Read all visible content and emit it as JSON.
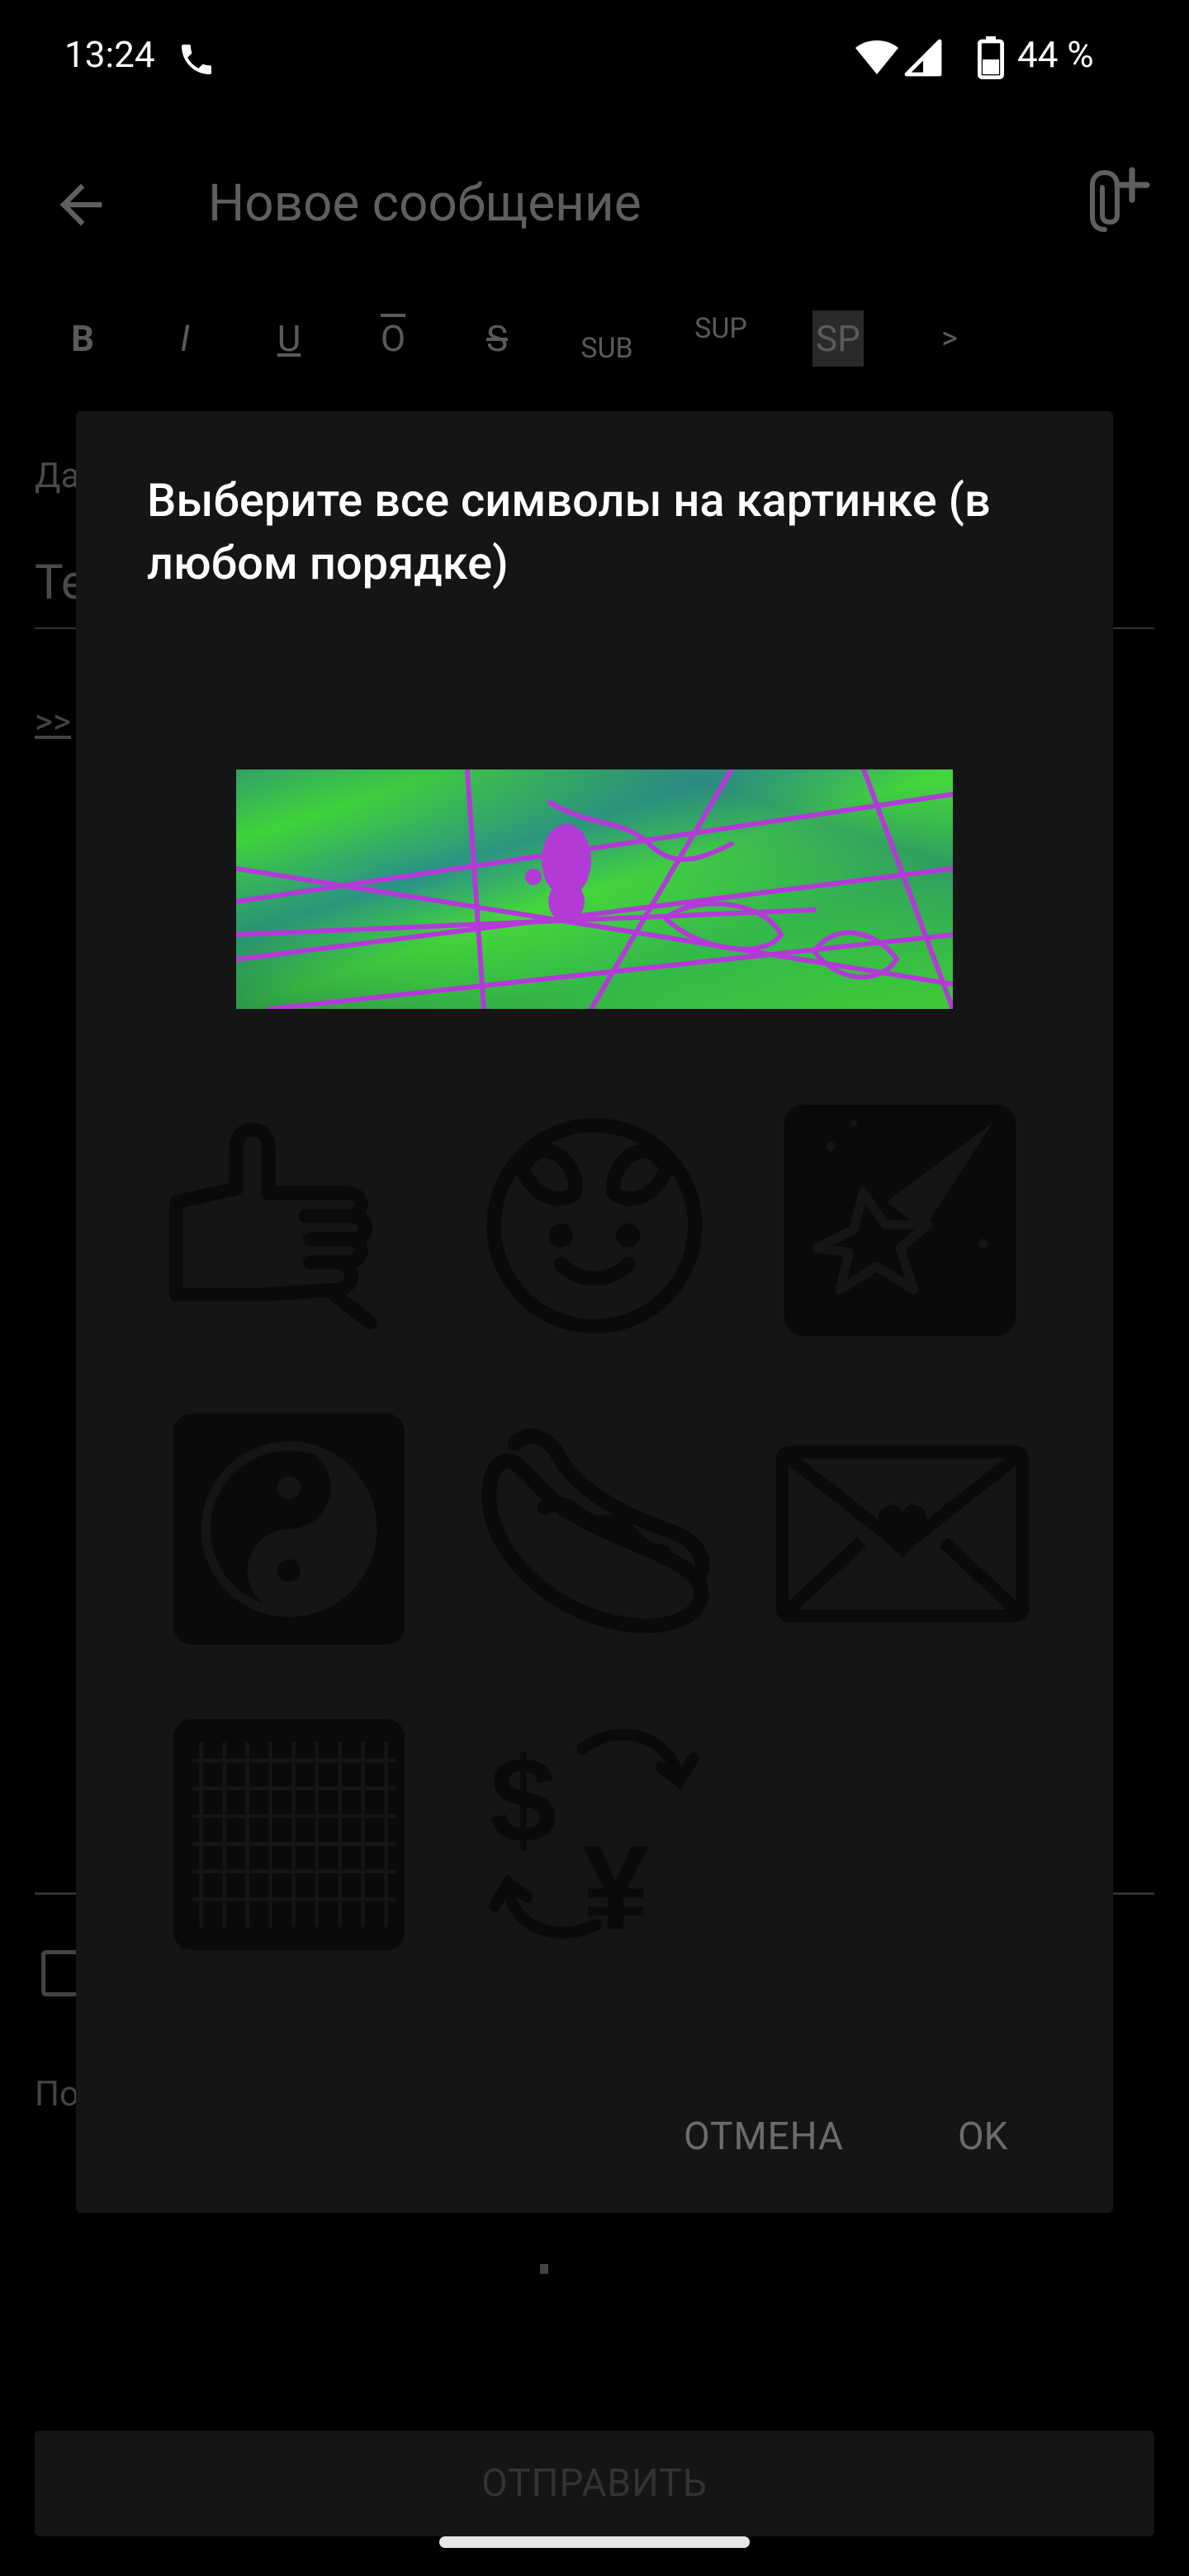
{
  "status_bar": {
    "time": "13:24",
    "battery": "44 %",
    "icons": [
      "phone-call-icon",
      "wifi-icon",
      "signal-icon",
      "battery-icon"
    ]
  },
  "app_bar": {
    "title": "Новое сообщение"
  },
  "format_toolbar": {
    "bold": "B",
    "italic": "I",
    "underline": "U",
    "overline": "O",
    "strike": "S",
    "sub": "SUB",
    "sup": "SUP",
    "sp": "SP",
    "more": ">"
  },
  "background": {
    "field_label": "Да",
    "field_input": "Те",
    "quote": ">>",
    "footer_text": "По",
    "send_button": "ОТПРАВИТЬ"
  },
  "dialog": {
    "title": "Выберите все символы на картинке (в любом порядке)",
    "symbols": [
      "shaka-hand-icon",
      "smiley-with-hands-icon",
      "shooting-star-icon",
      "yin-yang-icon",
      "hot-dog-icon",
      "heart-envelope-icon",
      "knit-pattern-icon",
      "currency-exchange-icon"
    ],
    "cancel_label": "ОТМЕНА",
    "ok_label": "OK"
  },
  "colors": {
    "background": "#000000",
    "dialog_bg": "#151515",
    "dim_text": "#5f5f5f",
    "captcha_green": "#3fd43a",
    "captcha_purple": "#b43ad8"
  }
}
